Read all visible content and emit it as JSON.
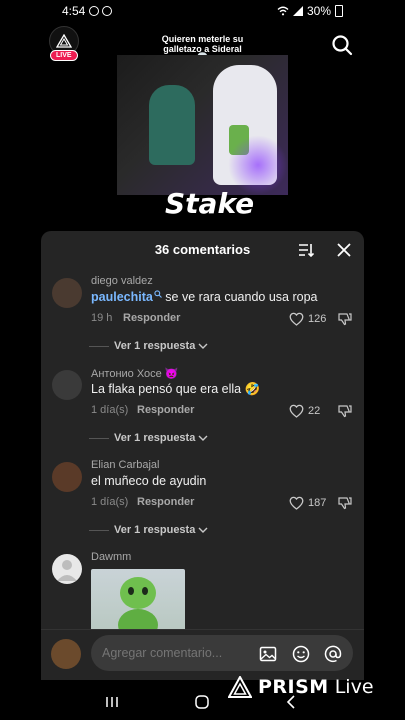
{
  "status_bar": {
    "time": "4:54",
    "battery": "30%"
  },
  "live_badge": "LIVE",
  "video": {
    "caption_line1": "Quieren meterle su",
    "caption_line2": "galletazo a Sideral",
    "skull": "💀",
    "sponsor": "Stake"
  },
  "comments_sheet": {
    "title": "36 comentarios",
    "comments": [
      {
        "user": "diego valdez",
        "mention": "paulechita",
        "text": " se ve rara cuando usa ropa",
        "time": "19 h",
        "reply_label": "Responder",
        "likes": "126",
        "view_replies": "Ver 1 respuesta"
      },
      {
        "user": "Антонио Хосе 👿",
        "text": "La flaka pensó que era ella 🤣",
        "time": "1 día(s)",
        "reply_label": "Responder",
        "likes": "22",
        "view_replies": "Ver 1 respuesta"
      },
      {
        "user": "Elian Carbajal",
        "text": "el muñeco de ayudin",
        "time": "1 día(s)",
        "reply_label": "Responder",
        "likes": "187",
        "view_replies": "Ver 1 respuesta"
      },
      {
        "user": "Dawmm"
      }
    ],
    "compose_placeholder": "Agregar comentario..."
  },
  "watermark": {
    "brand": "PRISM",
    "suffix": "Live"
  },
  "colors": {
    "live_red": "#ee1d52",
    "mention_blue": "#7ab8ff",
    "sheet_bg": "#252525"
  }
}
